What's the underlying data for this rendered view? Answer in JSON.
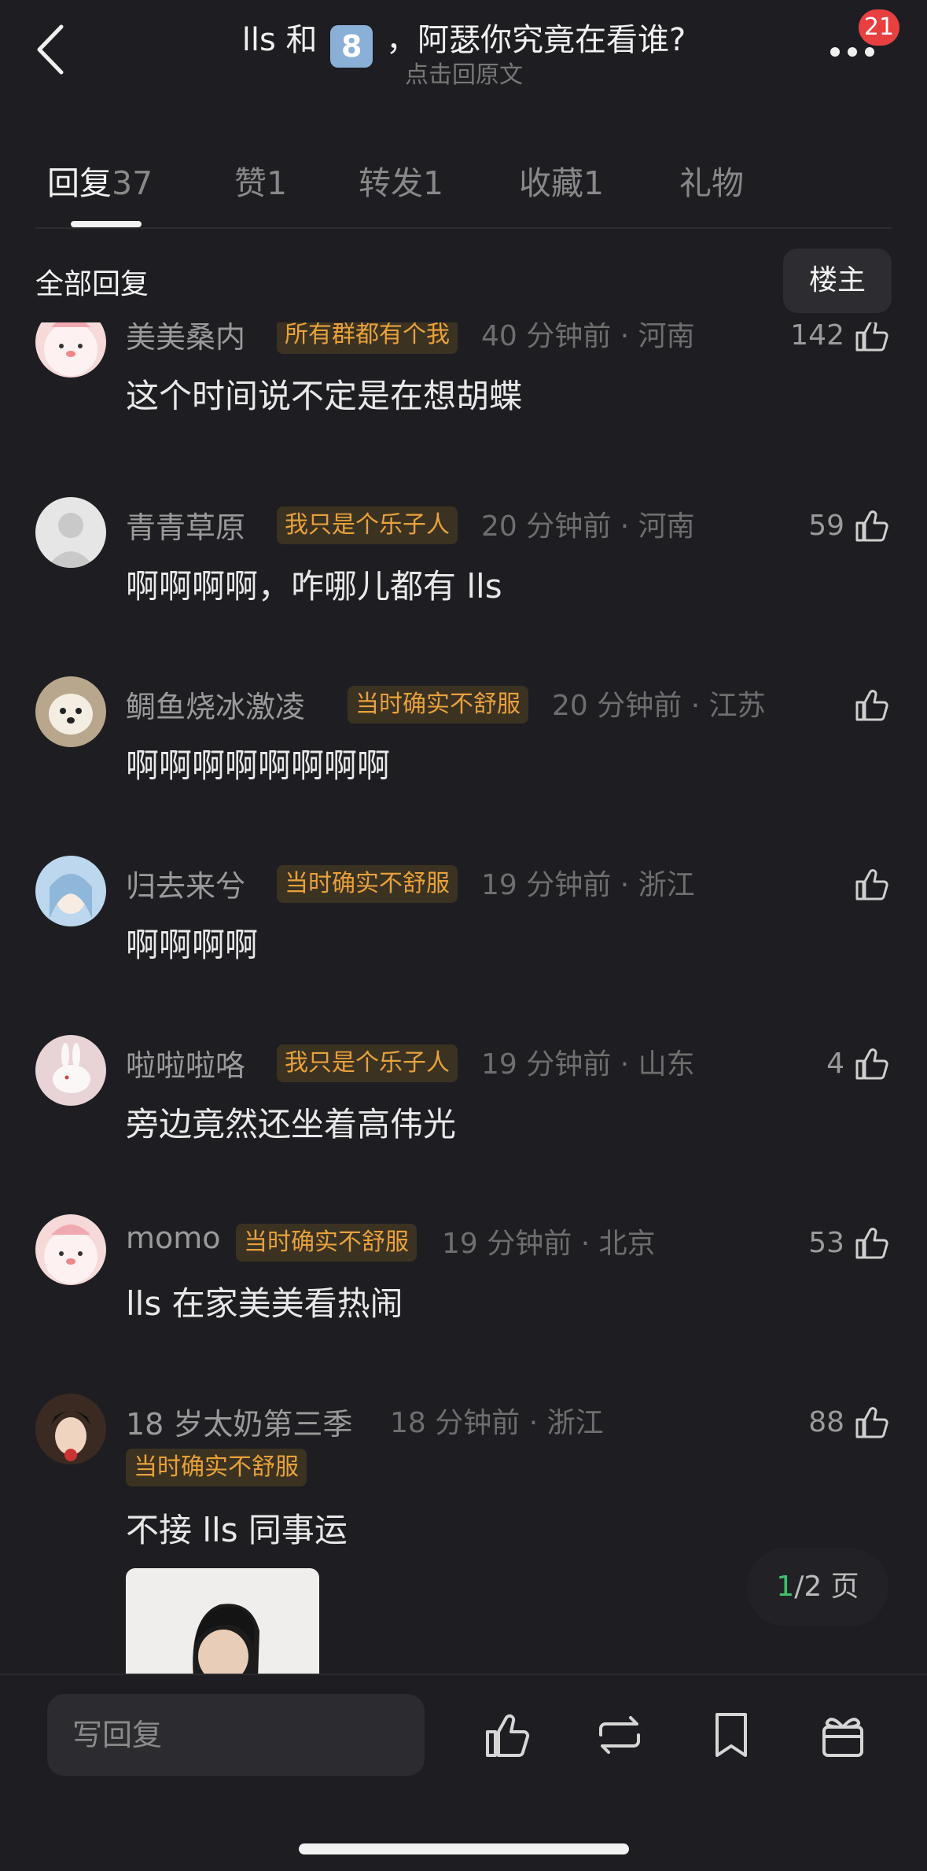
{
  "header": {
    "title_pre": "lls 和",
    "title_key": "8",
    "title_post": "，阿瑟你究竟在看谁?",
    "subtitle": "点击回原文",
    "notification_count": "21"
  },
  "tabs": [
    {
      "label": "回复",
      "count": "37"
    },
    {
      "label": "赞",
      "count": "1"
    },
    {
      "label": "转发",
      "count": "1"
    },
    {
      "label": "收藏",
      "count": "1"
    },
    {
      "label": "礼物",
      "count": ""
    }
  ],
  "filter": {
    "all_label": "全部回复",
    "owner_button": "楼主"
  },
  "replies": [
    {
      "username": "美美桑内",
      "tag": "所有群都有个我",
      "time": "40 分钟前",
      "location": "河南",
      "text": "这个时间说不定是在想胡蝶",
      "likes": "142"
    },
    {
      "username": "青青草原",
      "tag": "我只是个乐子人",
      "time": "20 分钟前",
      "location": "河南",
      "text": "啊啊啊啊，咋哪儿都有 lls",
      "likes": "59"
    },
    {
      "username": "鲷鱼烧冰激凌",
      "tag": "当时确实不舒服",
      "time": "20 分钟前",
      "location": "江苏",
      "text": "啊啊啊啊啊啊啊啊",
      "likes": ""
    },
    {
      "username": "归去来兮",
      "tag": "当时确实不舒服",
      "time": "19 分钟前",
      "location": "浙江",
      "text": "啊啊啊啊",
      "likes": ""
    },
    {
      "username": "啦啦啦咯",
      "tag": "我只是个乐子人",
      "time": "19 分钟前",
      "location": "山东",
      "text": "旁边竟然还坐着高伟光",
      "likes": "4"
    },
    {
      "username": "momo",
      "tag": "当时确实不舒服",
      "time": "19 分钟前",
      "location": "北京",
      "text": "lls 在家美美看热闹",
      "likes": "53"
    },
    {
      "username": "18 岁太奶第三季",
      "tag": "当时确实不舒服",
      "time": "18 分钟前",
      "location": "浙江",
      "text": "不接 lls 同事运",
      "likes": "88"
    }
  ],
  "page_indicator": {
    "current": "1",
    "total": "/2 页"
  },
  "bottom": {
    "reply_placeholder": "写回复",
    "icons": [
      "like-icon",
      "repost-icon",
      "bookmark-icon",
      "gift-icon"
    ]
  },
  "colors": {
    "background": "#1e1e22",
    "tag_bg": "#3b3222",
    "tag_text": "#e9a13b",
    "badge": "#e8403f",
    "page_current": "#3fbf6f"
  }
}
